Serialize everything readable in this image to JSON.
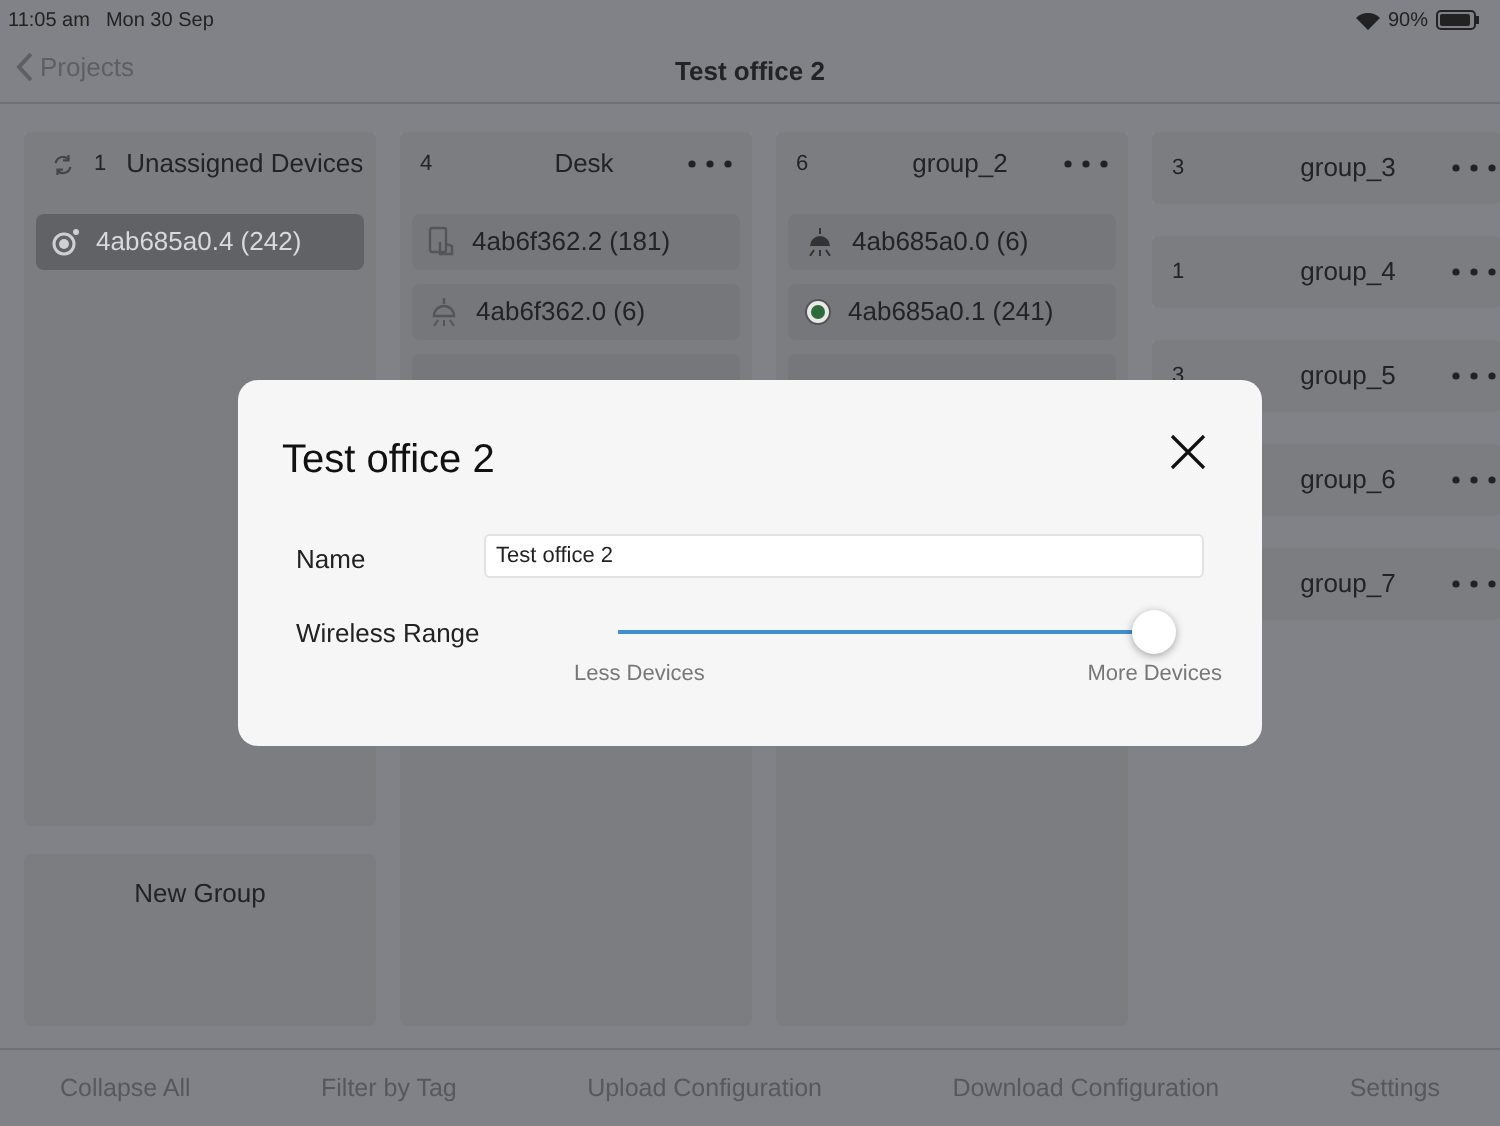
{
  "status_bar": {
    "time": "11:05 am",
    "date": "Mon 30 Sep",
    "battery": "90%"
  },
  "nav": {
    "back": "Projects",
    "title": "Test office 2"
  },
  "unassigned": {
    "count": "1",
    "title": "Unassigned Devices",
    "devices": [
      {
        "kind": "device",
        "label": "4ab685a0.4 (242)",
        "selected": true
      }
    ]
  },
  "new_group": "New Group",
  "groups": [
    {
      "kind": "expanded",
      "count": "4",
      "title": "Desk",
      "devices": [
        {
          "kind": "device",
          "label": "4ab6f362.2 (181)",
          "selected": false
        },
        {
          "kind": "device",
          "label": "4ab6f362.0 (6)",
          "selected": false
        },
        {
          "kind": "covered",
          "selected": false
        }
      ]
    },
    {
      "kind": "expanded",
      "count": "6",
      "title": "group_2",
      "devices": [
        {
          "kind": "device",
          "label": "4ab685a0.0 (6)",
          "selected": false
        },
        {
          "kind": "device",
          "label": "4ab685a0.1 (241)",
          "selected": false
        },
        {
          "kind": "covered",
          "selected": false
        }
      ]
    },
    {
      "kind": "collapsed",
      "count": "3",
      "title": "group_3"
    },
    {
      "kind": "collapsed",
      "count": "1",
      "title": "group_4"
    },
    {
      "kind": "collapsed",
      "count": "3",
      "title": "group_5"
    },
    {
      "kind": "collapsed",
      "title": "group_6"
    },
    {
      "kind": "collapsed",
      "title": "group_7"
    }
  ],
  "toolbar": [
    "Collapse All",
    "Filter by Tag",
    "Upload Configuration",
    "Download Configuration",
    "Settings"
  ],
  "dialog": {
    "title": "Test office 2",
    "name_label": "Name",
    "name_value": "Test office 2",
    "range_label": "Wireless Range",
    "level": 1,
    "min_label": "Less Devices",
    "max_label": "More Devices"
  }
}
